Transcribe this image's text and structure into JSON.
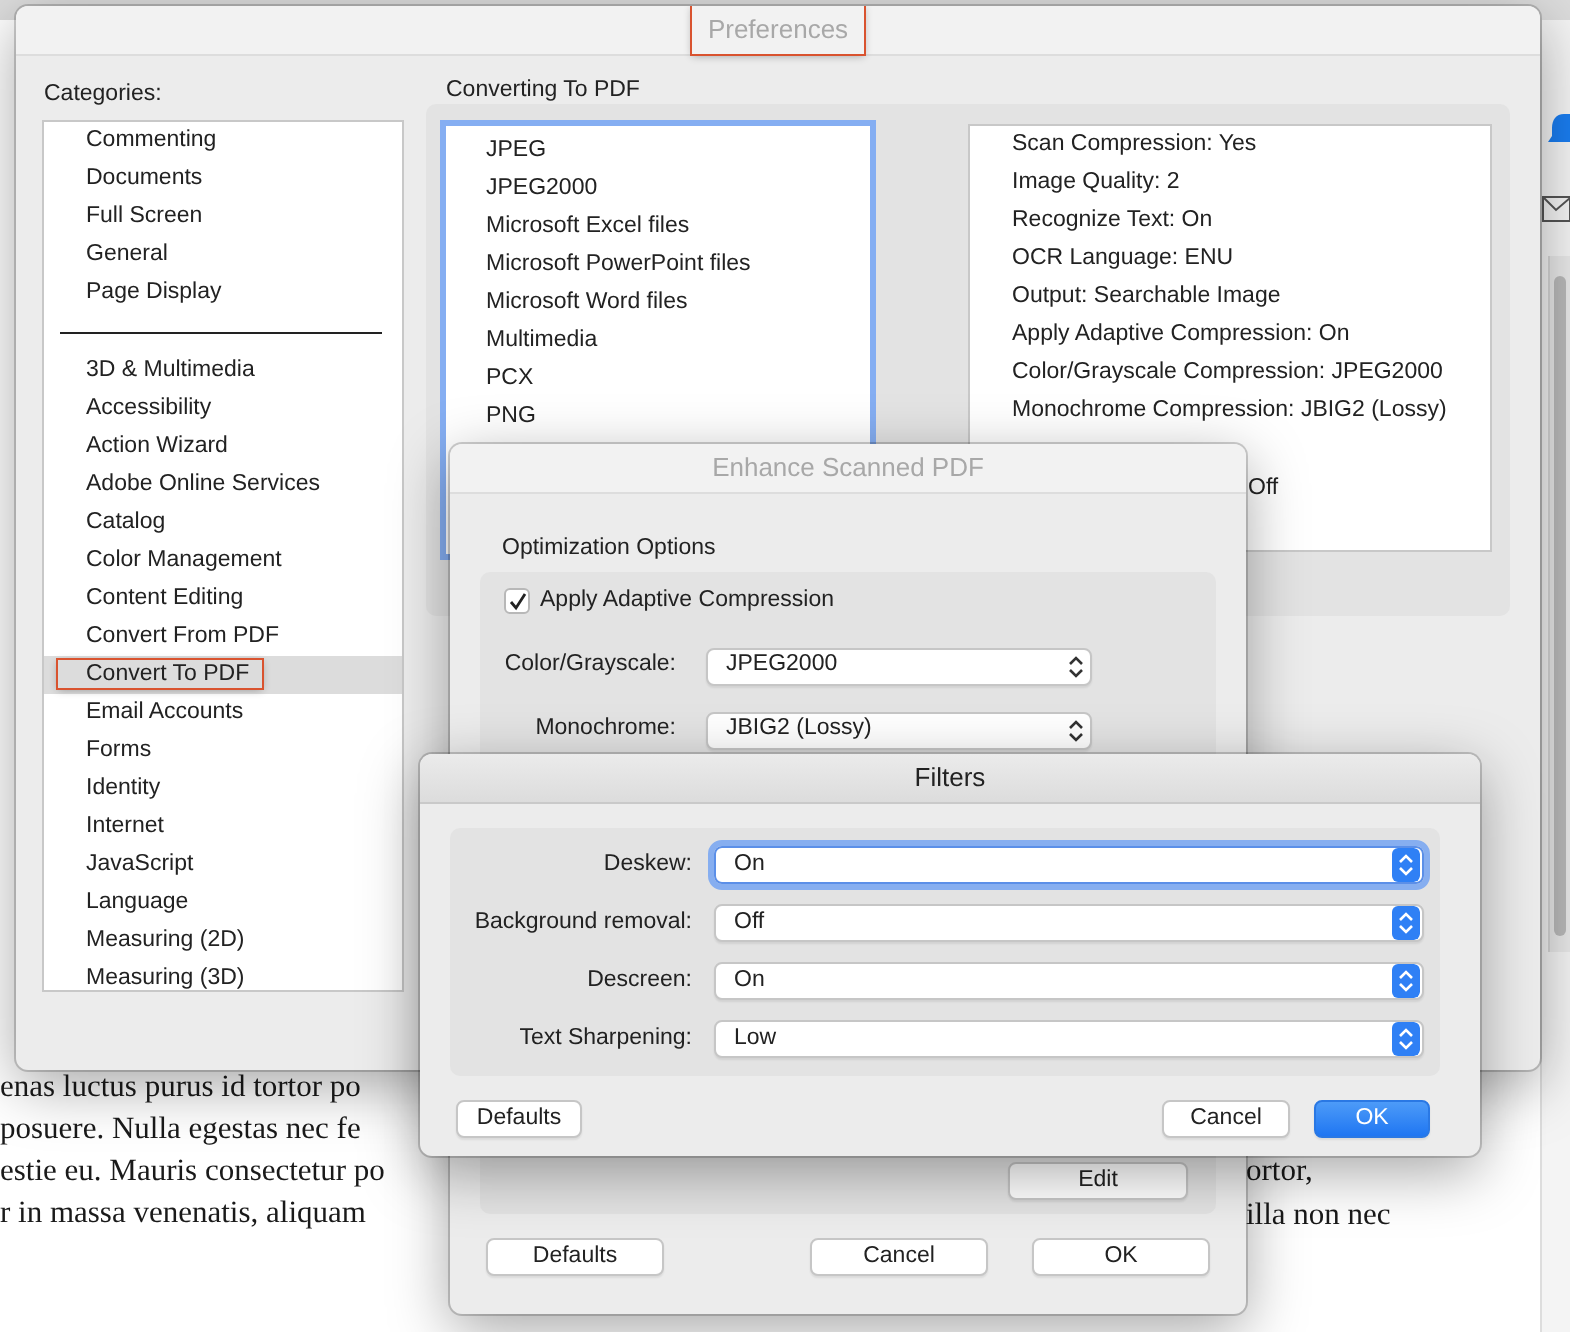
{
  "document": {
    "left_lines": [
      "enas luctus purus id tortor po",
      "posuere. Nulla egestas nec fe",
      "estie eu. Mauris consectetur po",
      "r in massa venenatis, aliquam"
    ],
    "right_lines": [
      "ortor,",
      "illa non nec"
    ]
  },
  "preferences": {
    "title": "Preferences",
    "active": false,
    "title_highlighted": true,
    "categories_label": "Categories:",
    "category_groups": [
      {
        "items": [
          {
            "label": "Commenting",
            "selected": false,
            "highlighted": false
          },
          {
            "label": "Documents",
            "selected": false,
            "highlighted": false
          },
          {
            "label": "Full Screen",
            "selected": false,
            "highlighted": false
          },
          {
            "label": "General",
            "selected": false,
            "highlighted": false
          },
          {
            "label": "Page Display",
            "selected": false,
            "highlighted": false
          }
        ]
      },
      {
        "items": [
          {
            "label": "3D & Multimedia",
            "selected": false,
            "highlighted": false
          },
          {
            "label": "Accessibility",
            "selected": false,
            "highlighted": false
          },
          {
            "label": "Action Wizard",
            "selected": false,
            "highlighted": false
          },
          {
            "label": "Adobe Online Services",
            "selected": false,
            "highlighted": false
          },
          {
            "label": "Catalog",
            "selected": false,
            "highlighted": false
          },
          {
            "label": "Color Management",
            "selected": false,
            "highlighted": false
          },
          {
            "label": "Content Editing",
            "selected": false,
            "highlighted": false
          },
          {
            "label": "Convert From PDF",
            "selected": false,
            "highlighted": false
          },
          {
            "label": "Convert To PDF",
            "selected": true,
            "highlighted": true
          },
          {
            "label": "Email Accounts",
            "selected": false,
            "highlighted": false
          },
          {
            "label": "Forms",
            "selected": false,
            "highlighted": false
          },
          {
            "label": "Identity",
            "selected": false,
            "highlighted": false
          },
          {
            "label": "Internet",
            "selected": false,
            "highlighted": false
          },
          {
            "label": "JavaScript",
            "selected": false,
            "highlighted": false
          },
          {
            "label": "Language",
            "selected": false,
            "highlighted": false
          },
          {
            "label": "Measuring (2D)",
            "selected": false,
            "highlighted": false
          },
          {
            "label": "Measuring (3D)",
            "selected": false,
            "highlighted": false
          }
        ]
      }
    ],
    "section_label": "Converting To PDF",
    "file_types": {
      "focused": true,
      "items": [
        "JPEG",
        "JPEG2000",
        "Microsoft Excel files",
        "Microsoft PowerPoint files",
        "Microsoft Word files",
        "Multimedia",
        "PCX",
        "PNG"
      ]
    },
    "settings": [
      {
        "text": "Scan Compression: Yes",
        "kind": "full"
      },
      {
        "text": "Image Quality: 2",
        "kind": "full"
      },
      {
        "text": "Recognize Text: On",
        "kind": "full"
      },
      {
        "text": "OCR Language: ENU",
        "kind": "full"
      },
      {
        "text": "Output: Searchable Image",
        "kind": "full"
      },
      {
        "text": "Apply Adaptive Compression: On",
        "kind": "full"
      },
      {
        "text": "Color/Grayscale Compression: JPEG2000",
        "kind": "full"
      },
      {
        "text": "Monochrome Compression: JBIG2 (Lossy)",
        "kind": "full"
      },
      {
        "text": "Off",
        "kind": "covered"
      }
    ]
  },
  "enhance_dialog": {
    "title": "Enhance Scanned PDF",
    "active": false,
    "section_label": "Optimization Options",
    "checkbox": {
      "label": "Apply Adaptive Compression",
      "checked": true
    },
    "fields": [
      {
        "label": "Color/Grayscale:",
        "value": "JPEG2000"
      },
      {
        "label": "Monochrome:",
        "value": "JBIG2 (Lossy)"
      }
    ],
    "edit_button": "Edit",
    "buttons": [
      {
        "label": "Defaults",
        "default": false
      },
      {
        "label": "Cancel",
        "default": false
      },
      {
        "label": "OK",
        "default": false
      }
    ]
  },
  "filters_dialog": {
    "title": "Filters",
    "active": true,
    "fields": [
      {
        "label": "Deskew:",
        "value": "On",
        "focused": true
      },
      {
        "label": "Background removal:",
        "value": "Off",
        "focused": false
      },
      {
        "label": "Descreen:",
        "value": "On",
        "focused": false
      },
      {
        "label": "Text Sharpening:",
        "value": "Low",
        "focused": false
      }
    ],
    "buttons": [
      {
        "label": "Defaults",
        "default": false
      },
      {
        "label": "Cancel",
        "default": false
      },
      {
        "label": "OK",
        "default": true
      }
    ]
  }
}
